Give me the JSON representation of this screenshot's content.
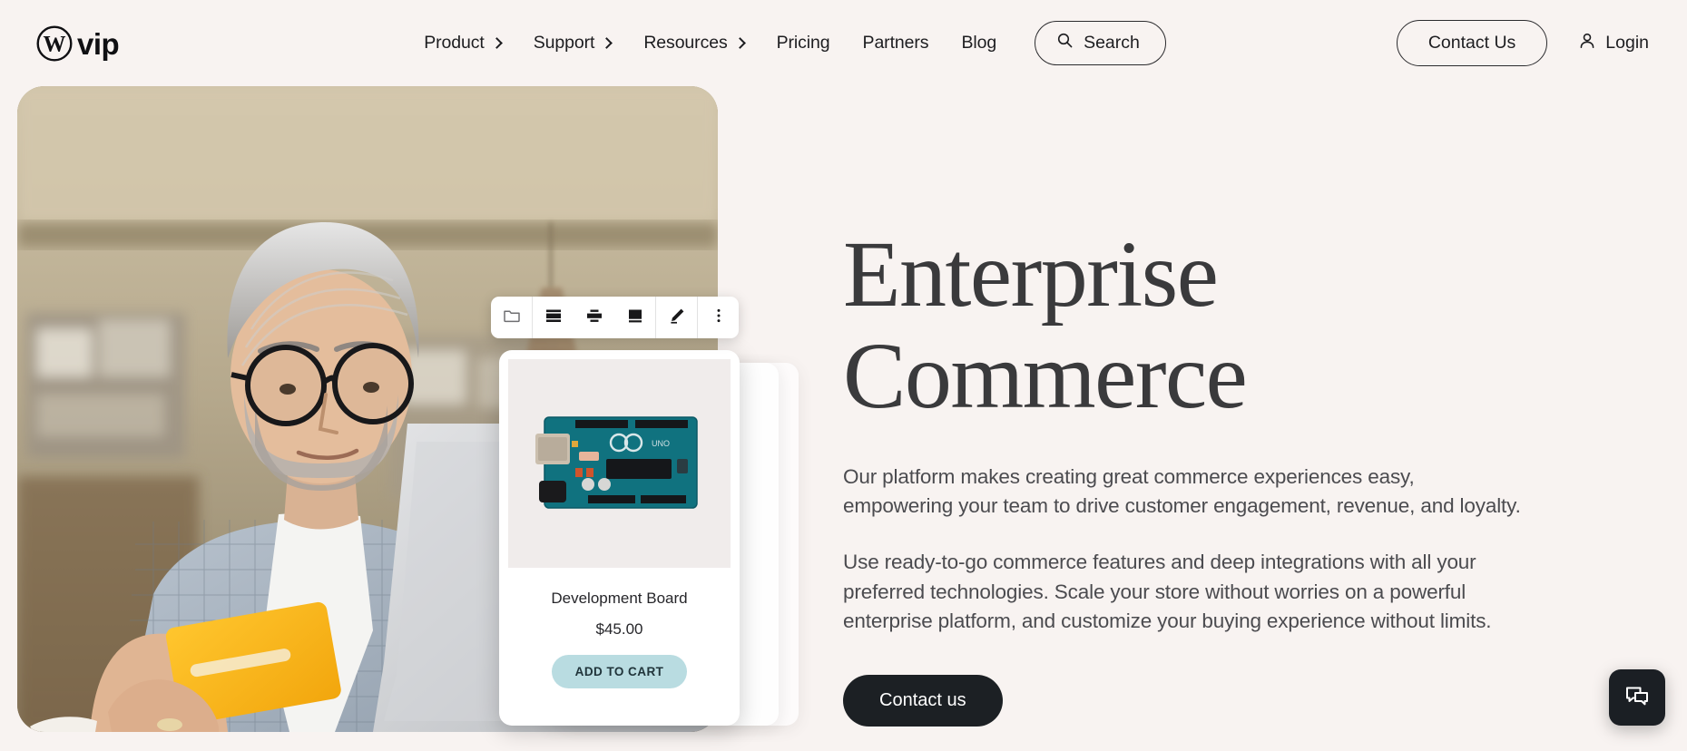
{
  "theme": {
    "page_background": "#f8f3f1",
    "text_primary": "#1d1d20",
    "heading_color": "#3a3a3c",
    "body_text": "#4b4b4f",
    "cta_background": "#1c2024",
    "cta_text": "#ffffff",
    "add_to_cart_background": "#b9dce1",
    "chat_widget_background": "#1b1f24"
  },
  "header": {
    "brand": {
      "icon": "wordpress-logo-icon",
      "wordmark": "vip"
    },
    "nav_items": [
      {
        "label": "Product",
        "has_submenu": true,
        "icon": "chevron-right-icon"
      },
      {
        "label": "Support",
        "has_submenu": true,
        "icon": "chevron-right-icon"
      },
      {
        "label": "Resources",
        "has_submenu": true,
        "icon": "chevron-right-icon"
      },
      {
        "label": "Pricing",
        "has_submenu": false,
        "icon": ""
      },
      {
        "label": "Partners",
        "has_submenu": false,
        "icon": ""
      },
      {
        "label": "Blog",
        "has_submenu": false,
        "icon": ""
      }
    ],
    "search": {
      "label": "Search",
      "icon": "search-icon"
    },
    "contact_button": "Contact Us",
    "login": {
      "label": "Login",
      "icon": "user-icon"
    }
  },
  "hero": {
    "title_line_1": "Enterprise",
    "title_line_2": "Commerce",
    "paragraph_1": "Our platform makes creating great commerce experiences easy, empowering your team to drive customer engagement, revenue, and loyalty.",
    "paragraph_2": "Use ready-to-go commerce features and deep integrations with all your preferred technologies. Scale your store without worries on a powerful enterprise platform, and customize your buying experience without limits.",
    "cta_label": "Contact us",
    "image_alt": "Man with gray hair and glasses in a checked blazer holding a yellow credit card while using a laptop"
  },
  "editor_toolbar": {
    "items": [
      {
        "icon": "folder-icon",
        "label": "Folder"
      },
      {
        "icon": "align-full-width-icon",
        "label": "Full width"
      },
      {
        "icon": "align-center-icon",
        "label": "Align center"
      },
      {
        "icon": "align-block-icon",
        "label": "Block"
      },
      {
        "icon": "pencil-edit-icon",
        "label": "Edit"
      },
      {
        "icon": "more-options-icon",
        "label": "More options"
      }
    ]
  },
  "product_card": {
    "image": "arduino-development-board-image",
    "title": "Development Board",
    "price": "$45.00",
    "add_to_cart_label": "ADD TO CART"
  },
  "chat_widget": {
    "icon": "chat-bubbles-icon",
    "label": "Open chat"
  }
}
